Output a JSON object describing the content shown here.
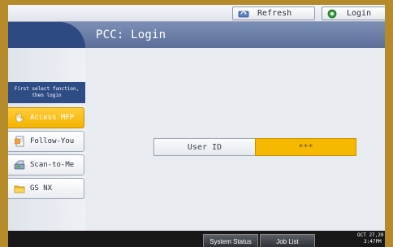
{
  "topbar": {
    "refresh_label": "Refresh",
    "login_label": "Login"
  },
  "page": {
    "title": "PCC: Login"
  },
  "sidebar": {
    "instruction": "First select function, then login",
    "items": [
      {
        "label": "Access MFP",
        "icon": "hand-icon",
        "active": true
      },
      {
        "label": "Follow-You",
        "icon": "document-icon",
        "active": false
      },
      {
        "label": "Scan-to-Me",
        "icon": "scanner-icon",
        "active": false
      },
      {
        "label": "GS NX",
        "icon": "folder-icon",
        "active": false
      }
    ]
  },
  "login_form": {
    "user_id_label": "User ID",
    "user_id_value": "***"
  },
  "bottombar": {
    "system_status_label": "System Status",
    "job_list_label": "Job List",
    "date": "OCT  27,20",
    "time": "3:47PM"
  },
  "colors": {
    "accent": "#f6b800",
    "title_bar": "#6a7ea8",
    "sidebar_header": "#2e4c85"
  }
}
